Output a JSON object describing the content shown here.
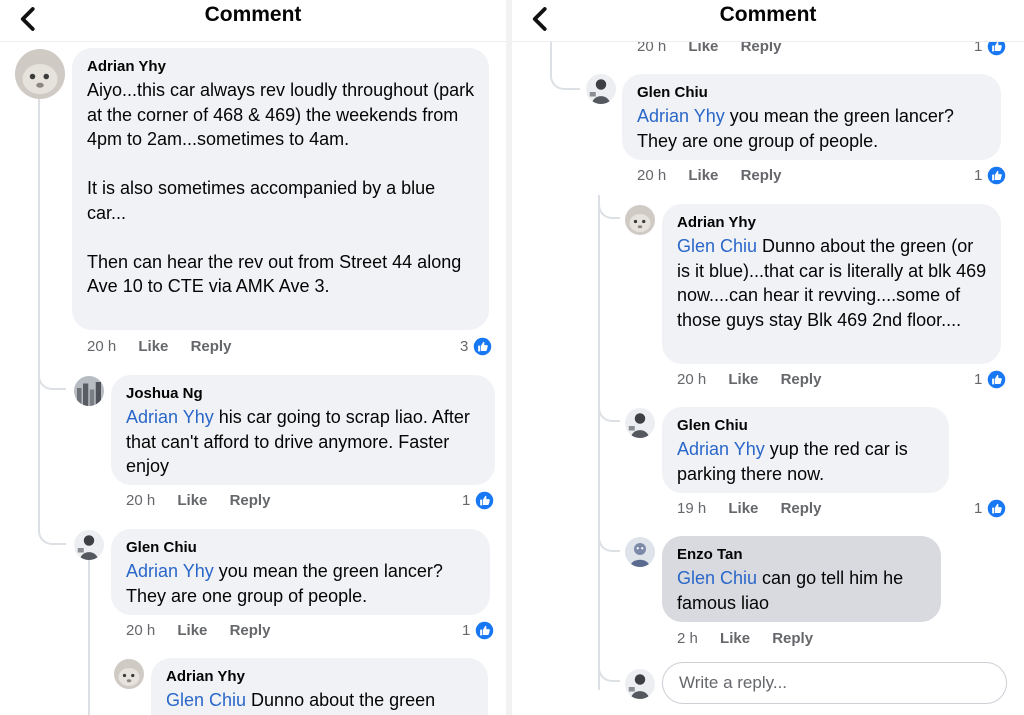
{
  "header": {
    "title": "Comment"
  },
  "left": {
    "comments": [
      {
        "author": "Adrian Yhy",
        "text": "Aiyo...this car always rev loudly throughout (park at the corner of 468 & 469) the weekends from 4pm to 2am...sometimes to 4am.\n\nIt is also sometimes accompanied by a blue car...\n\nThen can hear the rev out from Street 44 along Ave 10 to CTE via AMK Ave 3.",
        "time": "20 h",
        "like_label": "Like",
        "reply_label": "Reply",
        "reactions": "3"
      },
      {
        "author": "Joshua Ng",
        "mention": "Adrian Yhy",
        "text": " his car going to scrap liao. After that can't afford to drive anymore. Faster enjoy",
        "time": "20 h",
        "like_label": "Like",
        "reply_label": "Reply",
        "reactions": "1"
      },
      {
        "author": "Glen Chiu",
        "mention": "Adrian Yhy",
        "text": " you mean the green lancer? They are one group of people.",
        "time": "20 h",
        "like_label": "Like",
        "reply_label": "Reply",
        "reactions": "1"
      },
      {
        "author": "Adrian Yhy",
        "mention": "Glen Chiu",
        "text": " Dunno about the green"
      }
    ]
  },
  "right": {
    "top_partial": {
      "time": "20 h",
      "like_label": "Like",
      "reply_label": "Reply",
      "reactions": "1"
    },
    "comments": [
      {
        "author": "Glen Chiu",
        "mention": "Adrian Yhy",
        "text": " you mean the green lancer? They are one group of people.",
        "time": "20 h",
        "like_label": "Like",
        "reply_label": "Reply",
        "reactions": "1"
      },
      {
        "author": "Adrian Yhy",
        "mention": "Glen Chiu",
        "text": " Dunno about the green (or is it blue)...that car is literally at blk 469 now....can hear it revving....some of those guys stay Blk 469 2nd floor....",
        "time": "20 h",
        "like_label": "Like",
        "reply_label": "Reply",
        "reactions": "1"
      },
      {
        "author": "Glen Chiu",
        "mention": "Adrian Yhy",
        "text": " yup the red car is parking there now.",
        "time": "19 h",
        "like_label": "Like",
        "reply_label": "Reply",
        "reactions": "1"
      },
      {
        "author": "Enzo Tan",
        "mention": "Glen Chiu",
        "text": " can go tell him he famous liao",
        "time": "2 h",
        "like_label": "Like",
        "reply_label": "Reply"
      }
    ],
    "reply_placeholder": "Write a reply..."
  },
  "icons": {
    "back": "chevron-left-icon",
    "like": "like-thumb-icon"
  },
  "colors": {
    "mention": "#2a67c9",
    "like_blue": "#1877f2",
    "bubble": "#f0f2f5",
    "meta": "#65676b"
  }
}
